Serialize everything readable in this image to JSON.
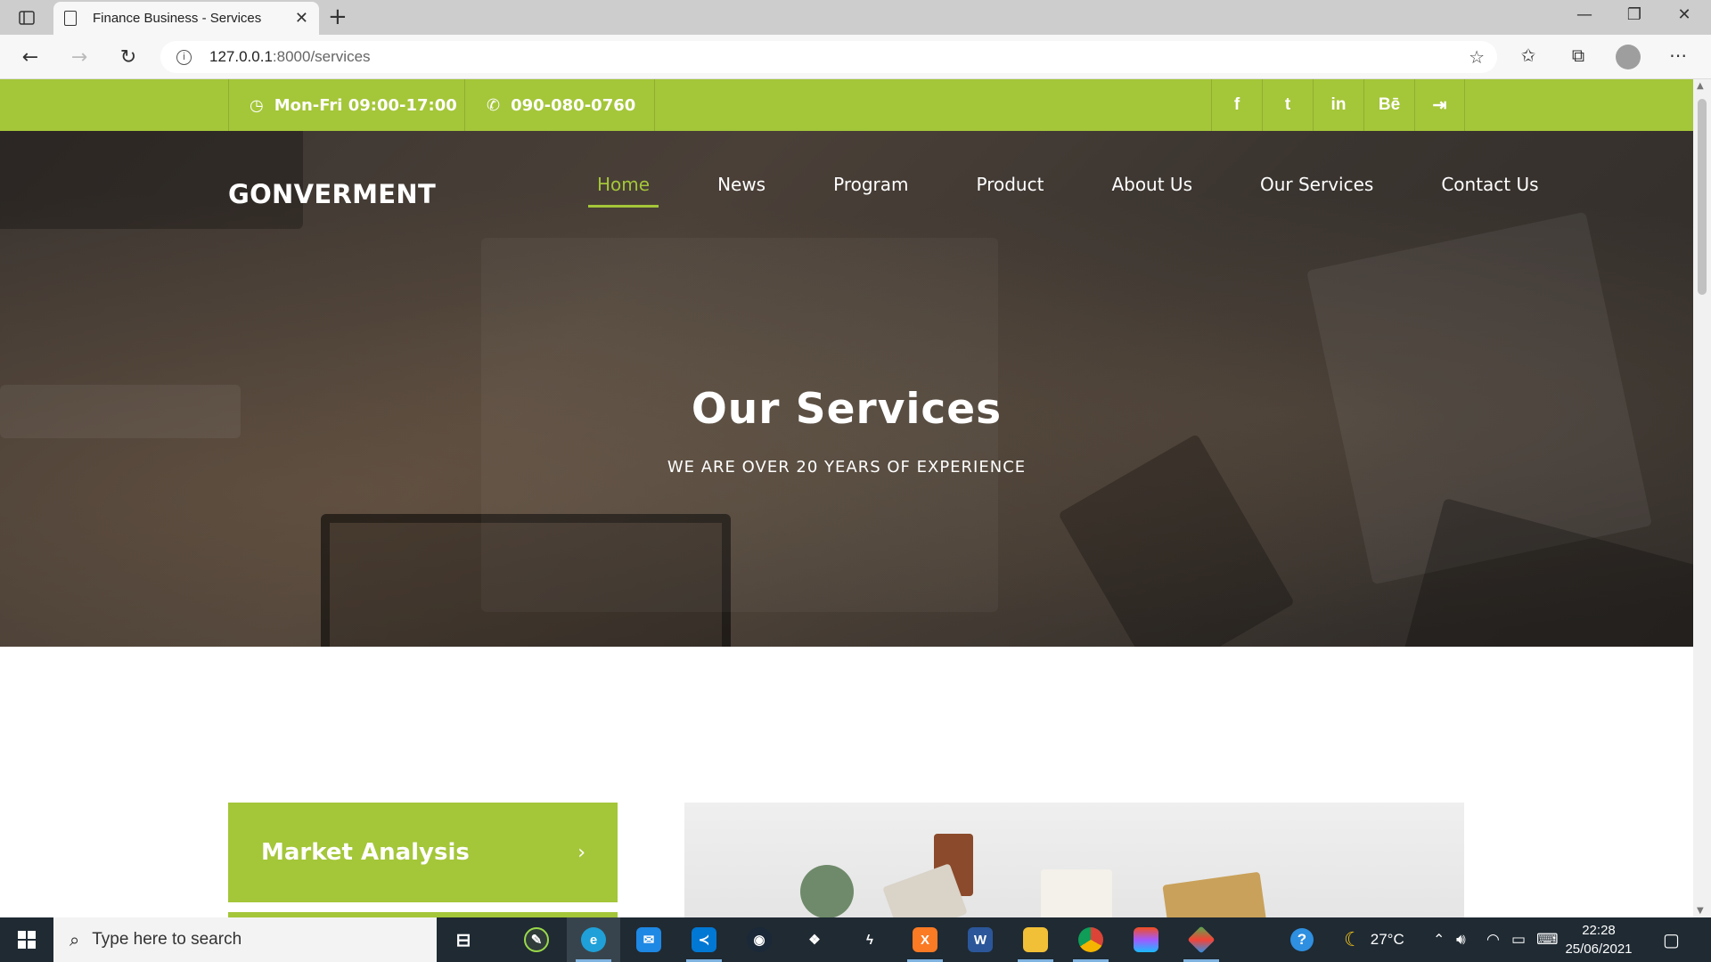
{
  "browser": {
    "tab_title": "Finance Business - Services",
    "url_host": "127.0.0.1",
    "url_rest": ":8000/services"
  },
  "topbar": {
    "hours": "Mon-Fri 09:00-17:00",
    "phone": "090-080-0760",
    "social": [
      "f",
      "t",
      "in",
      "Bē",
      "⇥"
    ]
  },
  "header": {
    "brand": "GONVERMENT",
    "nav": [
      {
        "label": "Home",
        "active": true
      },
      {
        "label": "News"
      },
      {
        "label": "Program"
      },
      {
        "label": "Product"
      },
      {
        "label": "About Us"
      },
      {
        "label": "Our Services"
      },
      {
        "label": "Contact Us"
      }
    ]
  },
  "hero": {
    "title": "Our Services",
    "subtitle": "WE ARE OVER 20 YEARS OF EXPERIENCE"
  },
  "services": {
    "first_item": "Market Analysis"
  },
  "taskbar": {
    "search_placeholder": "Type here to search",
    "weather": "27°C",
    "time": "22:28",
    "date": "25/06/2021"
  },
  "colors": {
    "accent": "#a4c639",
    "taskbar": "#1f2a33"
  }
}
